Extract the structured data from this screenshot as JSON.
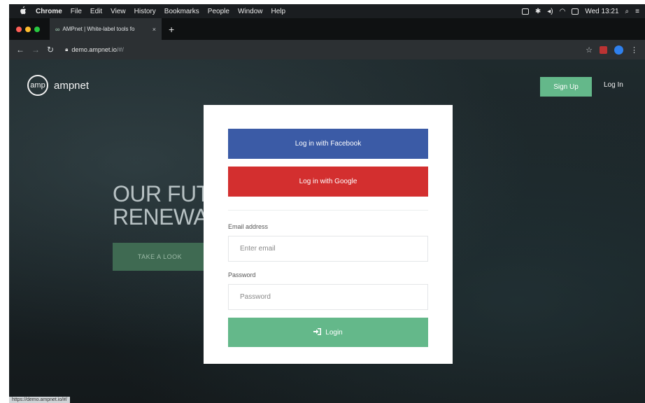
{
  "menubar": {
    "items": [
      "Chrome",
      "File",
      "Edit",
      "View",
      "History",
      "Bookmarks",
      "People",
      "Window",
      "Help"
    ],
    "clock": "Wed 13:21"
  },
  "tab": {
    "title": "AMPnet | White-label tools fo",
    "favicon": "∞"
  },
  "address": {
    "host": "demo.ampnet.io",
    "path": "/#/"
  },
  "site": {
    "logo_mark": "amp",
    "logo_word": "ampnet",
    "signup_label": "Sign Up",
    "login_label": "Log In",
    "hero_line1": "OUR FUT",
    "hero_line2": "RENEWA",
    "cta_label": "TAKE A LOOK"
  },
  "modal": {
    "facebook_label": "Log in with Facebook",
    "google_label": "Log in with Google",
    "email_label": "Email address",
    "email_placeholder": "Enter email",
    "password_label": "Password",
    "password_placeholder": "Password",
    "login_button": "Login"
  },
  "status_url": "https://demo.ampnet.io/#/",
  "colors": {
    "facebook": "#3b5ba6",
    "google": "#d32f2f",
    "accent_green": "#64b88a"
  }
}
